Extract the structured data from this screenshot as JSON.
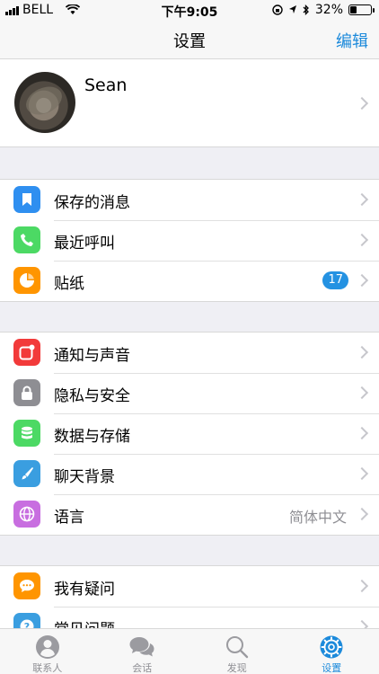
{
  "status": {
    "carrier": "BELL",
    "time": "下午9:05",
    "battery": "32%",
    "battery_level": 0.32
  },
  "nav": {
    "title": "设置",
    "edit_label": "编辑"
  },
  "profile": {
    "name": "Sean"
  },
  "groups": [
    {
      "items": [
        {
          "label": "保存的消息",
          "icon": "bookmark-icon",
          "color": "#2f8ff0"
        },
        {
          "label": "最近呼叫",
          "icon": "phone-icon",
          "color": "#4cd964"
        },
        {
          "label": "贴纸",
          "icon": "sticker-icon",
          "color": "#ff9500",
          "badge": "17"
        }
      ]
    },
    {
      "items": [
        {
          "label": "通知与声音",
          "icon": "notification-icon",
          "color": "#f23a3a"
        },
        {
          "label": "隐私与安全",
          "icon": "lock-icon",
          "color": "#8e8e93"
        },
        {
          "label": "数据与存储",
          "icon": "database-icon",
          "color": "#4cd964"
        },
        {
          "label": "聊天背景",
          "icon": "brush-icon",
          "color": "#3a9ee0"
        },
        {
          "label": "语言",
          "icon": "globe-icon",
          "color": "#c86ee0",
          "value": "简体中文"
        }
      ]
    },
    {
      "items": [
        {
          "label": "我有疑问",
          "icon": "chat-bubble-icon",
          "color": "#ff9500"
        },
        {
          "label": "常见问题",
          "icon": "question-icon",
          "color": "#3a9ee0"
        }
      ]
    }
  ],
  "tabs": [
    {
      "label": "联系人",
      "icon": "person-icon",
      "active": false
    },
    {
      "label": "会话",
      "icon": "chats-icon",
      "active": false
    },
    {
      "label": "发现",
      "icon": "search-icon",
      "active": false
    },
    {
      "label": "设置",
      "icon": "gear-icon",
      "active": true
    }
  ]
}
